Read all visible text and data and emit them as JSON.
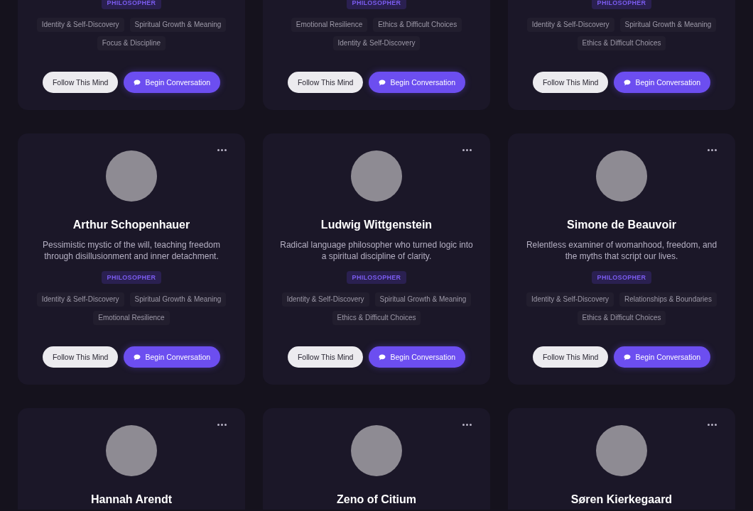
{
  "rows": [
    {
      "cards": [
        {
          "badge": "PHILOSOPHER",
          "topics": [
            "Identity & Self-Discovery",
            "Spiritual Growth & Meaning",
            "Focus & Discipline"
          ],
          "buttons": [
            {
              "label": "Follow This Mind",
              "kind": "secondary"
            },
            {
              "label": "Begin Conversation",
              "kind": "primary"
            }
          ]
        },
        {
          "badge": "PHILOSOPHER",
          "topics": [
            "Emotional Resilience",
            "Ethics & Difficult Choices",
            "Identity & Self-Discovery"
          ],
          "buttons": [
            {
              "label": "Follow This Mind",
              "kind": "secondary"
            },
            {
              "label": "Begin Conversation",
              "kind": "primary"
            }
          ]
        },
        {
          "badge": "PHILOSOPHER",
          "topics": [
            "Identity & Self-Discovery",
            "Spiritual Growth & Meaning",
            "Ethics & Difficult Choices"
          ],
          "buttons": [
            {
              "label": "Follow This Mind",
              "kind": "secondary"
            },
            {
              "label": "Begin Conversation",
              "kind": "primary"
            }
          ]
        }
      ]
    },
    {
      "cards": [
        {
          "menu": true,
          "avatar": true,
          "name": "Arthur Schopenhauer",
          "description": "Pessimistic mystic of the will, teaching freedom through disillusionment and inner detachment.",
          "badge": "PHILOSOPHER",
          "topics": [
            "Identity & Self-Discovery",
            "Spiritual Growth & Meaning",
            "Emotional Resilience"
          ],
          "buttons": [
            {
              "label": "Follow This Mind",
              "kind": "secondary"
            },
            {
              "label": "Begin Conversation",
              "kind": "primary"
            }
          ]
        },
        {
          "menu": true,
          "avatar": true,
          "name": "Ludwig Wittgenstein",
          "description": "Radical language philosopher who turned logic into a spiritual discipline of clarity.",
          "badge": "PHILOSOPHER",
          "topics": [
            "Identity & Self-Discovery",
            "Spiritual Growth & Meaning",
            "Ethics & Difficult Choices"
          ],
          "buttons": [
            {
              "label": "Follow This Mind",
              "kind": "secondary"
            },
            {
              "label": "Begin Conversation",
              "kind": "primary"
            }
          ]
        },
        {
          "menu": true,
          "avatar": true,
          "name": "Simone de Beauvoir",
          "description": "Relentless examiner of womanhood, freedom, and the myths that script our lives.",
          "badge": "PHILOSOPHER",
          "topics": [
            "Identity & Self-Discovery",
            "Relationships & Boundaries",
            "Ethics & Difficult Choices"
          ],
          "buttons": [
            {
              "label": "Follow This Mind",
              "kind": "secondary"
            },
            {
              "label": "Begin Conversation",
              "kind": "primary"
            }
          ]
        }
      ]
    },
    {
      "cards": [
        {
          "menu": true,
          "avatar": true,
          "name": "Hannah Arendt"
        },
        {
          "menu": true,
          "avatar": true,
          "name": "Zeno of Citium"
        },
        {
          "menu": true,
          "avatar": true,
          "name": "Søren Kierkegaard"
        }
      ]
    }
  ]
}
